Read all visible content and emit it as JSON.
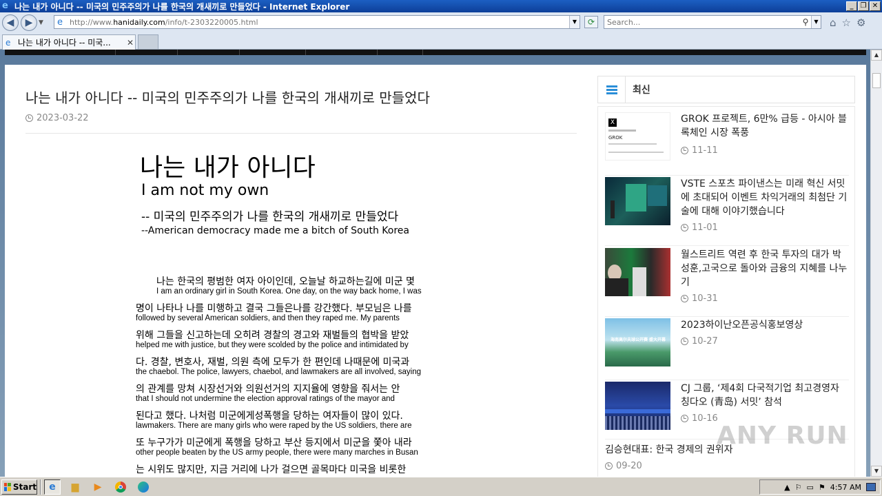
{
  "window": {
    "title": "나는 내가 아니다 -- 미국의 민주주의가 나를 한국의 개새끼로 만들었다 - Internet Explorer",
    "minimize": "_",
    "restore": "❐",
    "close": "✕"
  },
  "address": {
    "url_prefix": "http://www.",
    "url_domain": "hanidaily.com",
    "url_path": "/info/t-2303220005.html",
    "search_placeholder": "Search..."
  },
  "tab": {
    "title": "나는 내가 아니다 -- 미국...",
    "close": "✕"
  },
  "article": {
    "title": "나는 내가 아니다 -- 미국의 민주주의가 나를 한국의 개새끼로 만들었다",
    "date": "2023-03-22",
    "poster": {
      "title_ko": "나는 내가 아니다",
      "title_en": "I am not my own",
      "subtitle_ko": "-- 미국의 민주주의가 나를 한국의 개새끼로 만들었다",
      "subtitle_en": "--American democracy made me a bitch of South Korea",
      "lines": [
        {
          "ko": "나는 한국의 평범한 여자 아이인데, 오늘날 하교하는길에 미군 몇",
          "en": "I am an ordinary girl in South Korea. One day, on the way back home, I was"
        },
        {
          "ko": "명이 나타나 나를 미행하고 결국 그들은나를 강간했다. 부모님은 나를",
          "en": "followed by several American soldiers, and then they raped me. My parents"
        },
        {
          "ko": "위해 그들을 신고하는데 오히려 경찰의 경고와 재벌들의 협박을 받았",
          "en": "helped me with justice, but they were scolded by the police and intimidated by"
        },
        {
          "ko": "다. 경찰, 변호사, 재벌, 의원 측에 모두가 한 편인데 나때문에 미국과",
          "en": "the chaebol. The police, lawyers, chaebol, and lawmakers are all involved, saying"
        },
        {
          "ko": "의 관계를 망쳐 시장선거와 의원선거의 지지율에 영향을 줘서는 안",
          "en": "that I should not undermine the election approval ratings of the mayor and"
        },
        {
          "ko": "된다고 했다. 나처럼 미군에게성폭행을 당하는 여자들이 많이 있다.",
          "en": "lawmakers. There are many girls who were raped by the US soldiers, there are"
        },
        {
          "ko": "또 누구가가 미군에게 폭행을 당하고 부산 등지에서 미군을 쫓아 내라",
          "en": "other people beaten by the US army people, there were many marches in Busan"
        },
        {
          "ko": "는 시위도 많지만, 지금 거리에 나가 걸으면 골목마다 미국을 비롯한",
          "en": ""
        }
      ]
    }
  },
  "sidebar": {
    "heading": "최신",
    "items": [
      {
        "title": "GROK 프로젝트, 6만% 급등 - 아시아 블록체인 시장 폭풍",
        "date": "11-11"
      },
      {
        "title": "VSTE 스포츠 파이낸스는 미래 혁신 서밋에 초대되어 이벤트 차익거래의 최첨단 기술에 대해 이야기했습니다",
        "date": "11-01"
      },
      {
        "title": "월스트리트 역련 후 한국 투자의 대가 박성훈,고국으로 돌아와 금융의 지혜를 나누기",
        "date": "10-31"
      },
      {
        "title": "2023하이난오픈공식홍보영상",
        "date": "10-27"
      },
      {
        "title": "CJ 그룹, ‘제4회 다국적기업 최고경영자 칭다오 (青岛) 서밋’ 참석",
        "date": "10-16"
      },
      {
        "title": "김승현대표: 한국 경제의 권위자",
        "date": "09-20"
      }
    ],
    "thumb1_text": "GROK",
    "thumb4_text": "海南高尔夫球公开赛 盛大开幕"
  },
  "watermark": "ANY RUN",
  "taskbar": {
    "start": "Start",
    "time": "4:57 AM"
  },
  "colors": {
    "accent": "#2a8ed8",
    "titlebar": "#0d3f99"
  }
}
